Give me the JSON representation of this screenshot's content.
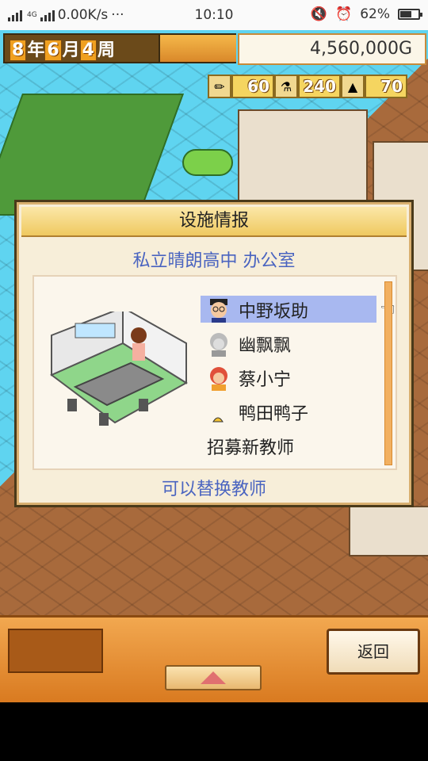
{
  "status_bar": {
    "net_label": "4G",
    "speed": "0.00K/s",
    "more": "···",
    "time": "10:10",
    "battery": "62%",
    "battery_level": 0.62
  },
  "hud": {
    "date": {
      "year_num": "8",
      "year_unit": "年",
      "month_num": "6",
      "month_unit": "月",
      "week_num": "4",
      "week_unit": "周"
    },
    "money": "4,560,000G",
    "stats": [
      {
        "icon": "pencil-icon",
        "value": "60"
      },
      {
        "icon": "flask-icon",
        "value": "240"
      },
      {
        "icon": "mountain-icon",
        "value": "70"
      }
    ]
  },
  "dialog": {
    "title": "设施情报",
    "subtitle": "私立晴朗高中 办公室",
    "teachers": [
      {
        "name": "中野坂助",
        "avatar": "teacher-glasses-avatar",
        "selected": true
      },
      {
        "name": "幽飘飘",
        "avatar": "teacher-ghost-avatar",
        "selected": false
      },
      {
        "name": "蔡小宁",
        "avatar": "teacher-redhair-avatar",
        "selected": false
      },
      {
        "name": "鸭田鸭子",
        "avatar": "teacher-duck-avatar",
        "selected": false
      }
    ],
    "recruit": "招募新教师",
    "footer": "可以替换教师"
  },
  "bottom": {
    "back_label": "返回"
  }
}
